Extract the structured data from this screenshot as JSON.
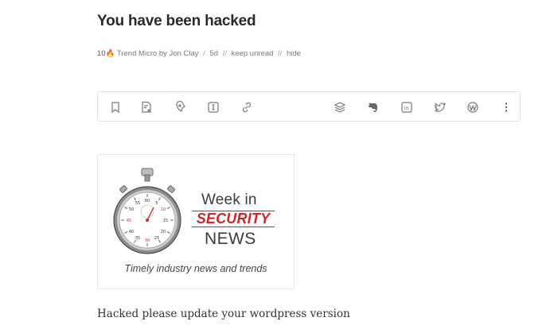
{
  "article": {
    "title": "You have been hacked",
    "meta": {
      "count": "10",
      "source": "Trend Micro by Jon Clay",
      "age": "5d",
      "keep_unread": "keep unread",
      "hide": "hide"
    },
    "body": "Hacked please update your wordpress version"
  },
  "toolbar": {
    "left_icons": [
      "bookmark-icon",
      "add-note-icon",
      "tag-icon",
      "text-view-icon",
      "link-icon"
    ],
    "right_icons": [
      "layers-icon",
      "evernote-icon",
      "linkedin-icon",
      "twitter-icon",
      "wordpress-icon",
      "more-icon"
    ]
  },
  "card": {
    "line1": "Week in",
    "line2": "SECURITY",
    "line3": "NEWS",
    "tagline": "Timely industry news and trends",
    "accent_color": "#d2232a"
  }
}
